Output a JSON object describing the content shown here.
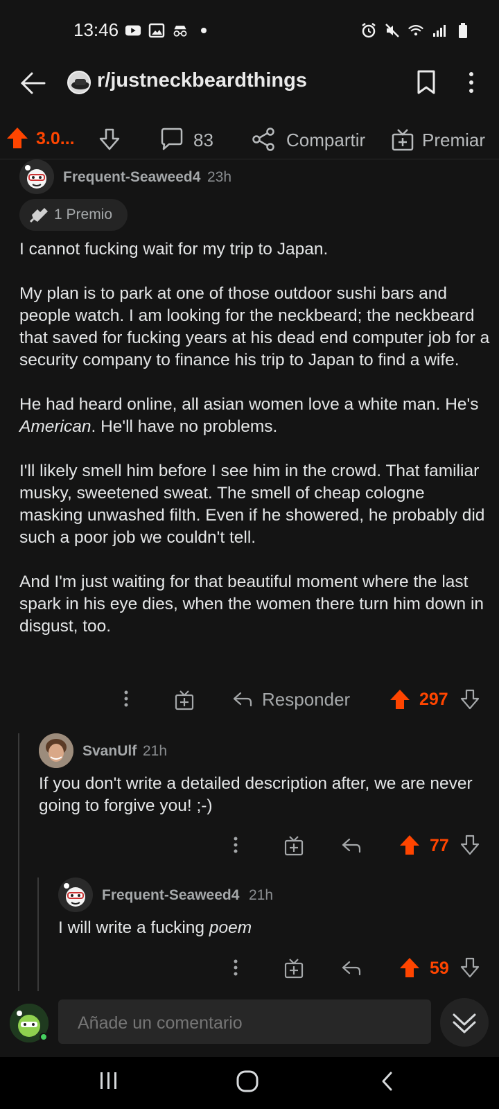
{
  "status_bar": {
    "time": "13:46",
    "left_icons": [
      "youtube-icon",
      "image-icon",
      "incognito-icon",
      "dot-icon"
    ],
    "right_icons": [
      "alarm-icon",
      "mute-icon",
      "wifi-icon",
      "signal-icon",
      "battery-icon"
    ]
  },
  "header": {
    "subreddit": "r/justneckbeardthings",
    "icons": [
      "back-arrow-icon",
      "bookmark-icon",
      "more-vertical-icon"
    ]
  },
  "action_bar": {
    "score": "3.0...",
    "comments_count": "83",
    "share_label": "Compartir",
    "award_label": "Premiar"
  },
  "comments": [
    {
      "author": "Frequent-Seaweed4",
      "time": "23h",
      "award": "1 Premio",
      "paragraphs": [
        "I cannot fucking wait for my trip to Japan.",
        "My plan is to park at one of those outdoor sushi bars and people watch. I am looking for the neckbeard; the neckbeard that saved for fucking years at his dead end computer job for a security company to finance his trip to Japan to find a wife.",
        "He had heard online, all asian women love a white man. He's",
        "American",
        ". He'll have no problems.",
        "I'll likely smell him before I see him in the crowd. That familiar musky, sweetened sweat. The smell of cheap cologne masking unwashed filth. Even if he showered, he probably did such a poor job we couldn't tell.",
        "And I'm just waiting for that beautiful moment where the last spark in his eye dies, when the women there turn him down in disgust, too."
      ],
      "reply_label": "Responder",
      "score": "297"
    },
    {
      "author": "SvanUlf",
      "time": "21h",
      "text": "If you don't write a detailed description after, we are never going to forgive you! ;-)",
      "score": "77"
    },
    {
      "author": "Frequent-Seaweed4",
      "time": "21h",
      "text_plain": "I will write a fucking ",
      "text_em": "poem",
      "score": "59"
    }
  ],
  "composer": {
    "placeholder": "Añade un comentario"
  },
  "colors": {
    "background": "#141414",
    "upvote": "#ff4500",
    "text": "#e4e6e7",
    "muted": "#a5a8aa"
  }
}
